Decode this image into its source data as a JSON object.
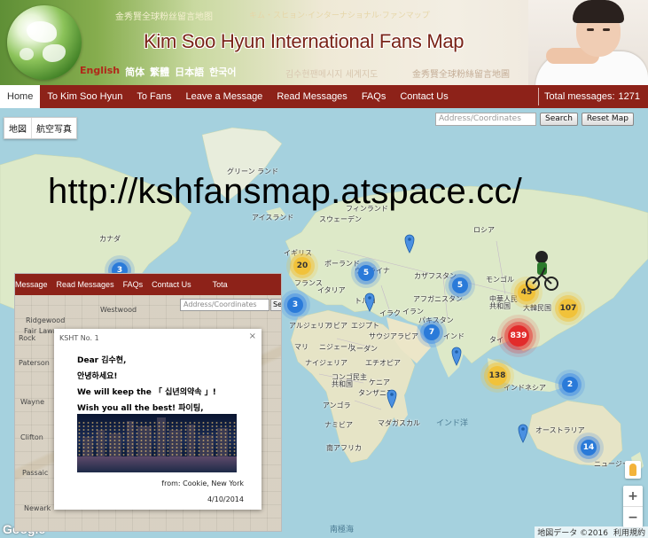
{
  "header": {
    "site_title": "Kim Soo Hyun International Fans Map",
    "subtitle_cn": "金秀賢全球粉丝留言地图",
    "subtitle_jp": "キム・スヒョン·インターナショナル·ファンマップ",
    "subtitle_kr": "김수현팬메시지 세계지도",
    "subtitle_tw": "金秀賢全球粉絲留言地圖",
    "languages": [
      "English",
      "简体",
      "繁體",
      "日本語",
      "한국어"
    ],
    "active_language": "English"
  },
  "nav": {
    "items": [
      "Home",
      "To Kim Soo Hyun",
      "To Fans",
      "Leave a Message",
      "Read Messages",
      "FAQs",
      "Contact Us"
    ],
    "active": "Home",
    "total_label": "Total messages:",
    "total_count": "1271"
  },
  "map": {
    "map_types": [
      "地図",
      "航空写真"
    ],
    "address_placeholder": "Address/Coordinates",
    "search_button": "Search",
    "reset_button": "Reset Map",
    "overlay_url": "http://kshfansmap.atspace.cc/",
    "labels": {
      "greenland": "グリーン\nランド",
      "iceland": "アイスランド",
      "sweden": "スウェーデン",
      "finland": "フィンランド",
      "russia": "ロシア",
      "canada": "カナダ",
      "uk": "イギリス",
      "poland": "ポーランド",
      "ukraine": "ウクライナ",
      "france": "フランス",
      "italy": "イタリア",
      "kazakhstan": "カザフスタン",
      "mongolia": "モンゴル",
      "china": "中華人民\n共和国",
      "korea": "大韓民国",
      "turkey": "トルコ",
      "iraq": "イラク",
      "iran": "イラン",
      "afghanistan": "アフガニスタン",
      "pakistan": "パキスタン",
      "india": "インド",
      "algeria": "アルジェリア",
      "libya": "リビア",
      "egypt": "エジプト",
      "saudi": "サウジアラビア",
      "mali": "マリ",
      "niger": "ニジェール",
      "sudan": "スーダン",
      "nigeria": "ナイジェリア",
      "ethiopia": "エチオピア",
      "congo": "コンゴ民主\n共和国",
      "kenya": "ケニア",
      "tanzania": "タンザニア",
      "angola": "アンゴラ",
      "namibia": "ナミビア",
      "madagascar": "マダガスカル",
      "south_africa": "南アフリカ",
      "indonesia": "インドネシア",
      "australia": "オーストラリア",
      "new_zealand": "ニュージー",
      "thailand": "タイ",
      "indian_ocean": "インド洋",
      "southern_ocean": "南極海"
    },
    "clusters": [
      {
        "label": "3",
        "color": "blue"
      },
      {
        "label": "20",
        "color": "yellow"
      },
      {
        "label": "5",
        "color": "blue"
      },
      {
        "label": "3",
        "color": "blue"
      },
      {
        "label": "5",
        "color": "blue"
      },
      {
        "label": "45",
        "color": "yellow"
      },
      {
        "label": "107",
        "color": "yellow"
      },
      {
        "label": "7",
        "color": "blue"
      },
      {
        "label": "839",
        "color": "red"
      },
      {
        "label": "138",
        "color": "yellow"
      },
      {
        "label": "2",
        "color": "blue"
      },
      {
        "label": "14",
        "color": "blue"
      }
    ],
    "google_logo": "Google",
    "attribution": "地図データ ©2016",
    "terms": "利用規約",
    "zoom_in": "+",
    "zoom_out": "−"
  },
  "inset": {
    "nav_items": [
      "Message",
      "Read Messages",
      "FAQs",
      "Contact Us",
      "Tota"
    ],
    "address_placeholder": "Address/Coordinates",
    "search_button": "Sear",
    "places": [
      "Ridgewood",
      "Westwood",
      "Fair Lawn",
      "Rock",
      "Paterson",
      "Wayne",
      "Clifton",
      "Passaic",
      "Newark"
    ],
    "popup": {
      "title": "KSHT No. 1",
      "close": "×",
      "lines": [
        "Dear 김수현,",
        "안녕하세요!",
        "We will keep the 「 십년의약속 」!",
        "Wish you all the best! 파이팅,"
      ],
      "from": "from: Cookie, New York",
      "date": "4/10/2014"
    }
  },
  "colors": {
    "nav_bg": "#8d2219",
    "title_color": "#7a2418",
    "ocean": "#a5d1de",
    "land": "#dde9c8"
  }
}
